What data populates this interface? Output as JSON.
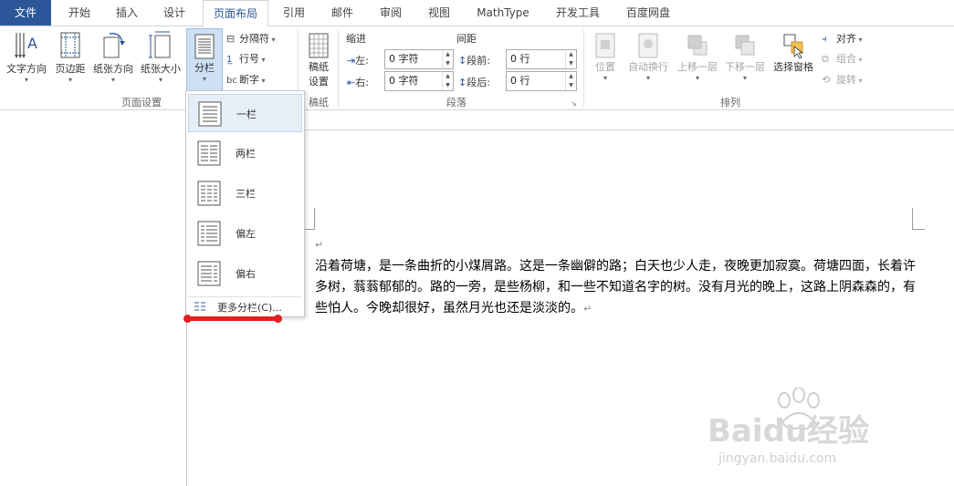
{
  "tabs": {
    "file": "文件",
    "home": "开始",
    "insert": "插入",
    "design": "设计",
    "layout": "页面布局",
    "references": "引用",
    "mailings": "邮件",
    "review": "审阅",
    "view": "视图",
    "mathtype": "MathType",
    "developer": "开发工具",
    "baidu": "百度网盘"
  },
  "page_setup": {
    "text_direction": "文字方向",
    "margins": "页边距",
    "orientation": "纸张方向",
    "size": "纸张大小",
    "columns": "分栏",
    "breaks": "分隔符",
    "line_numbers": "行号",
    "hyphenation": "断字",
    "group_label": "页面设置"
  },
  "manuscript": {
    "button_l1": "稿纸",
    "button_l2": "设置",
    "group_label": "稿纸"
  },
  "paragraph": {
    "indent_title": "缩进",
    "spacing_title": "间距",
    "left_label": "左:",
    "right_label": "右:",
    "before_label": "段前:",
    "after_label": "段后:",
    "left_value": "0 字符",
    "right_value": "0 字符",
    "before_value": "0 行",
    "after_value": "0 行",
    "group_label": "段落"
  },
  "arrange": {
    "position": "位置",
    "wrap_text": "自动换行",
    "bring_forward": "上移一层",
    "send_backward": "下移一层",
    "selection_pane": "选择窗格",
    "align": "对齐",
    "group": "组合",
    "rotate": "旋转",
    "group_label": "排列"
  },
  "columns_menu": {
    "one": "一栏",
    "two": "两栏",
    "three": "三栏",
    "left": "偏左",
    "right": "偏右",
    "more": "更多分栏(C)..."
  },
  "document": {
    "paragraph": "沿着荷塘，是一条曲折的小煤屑路。这是一条幽僻的路；白天也少人走，夜晚更加寂寞。荷塘四面，长着许多树，蓊蓊郁郁的。路的一旁，是些杨柳，和一些不知道名字的树。没有月光的晚上，这路上阴森森的，有些怕人。今晚却很好，虽然月光也还是淡淡的。",
    "para_mark": "↵"
  },
  "watermark": {
    "brand": "Baidu经验",
    "url": "jingyan.baidu.com"
  },
  "colors": {
    "accent": "#2b579a",
    "highlight": "#e02020"
  }
}
